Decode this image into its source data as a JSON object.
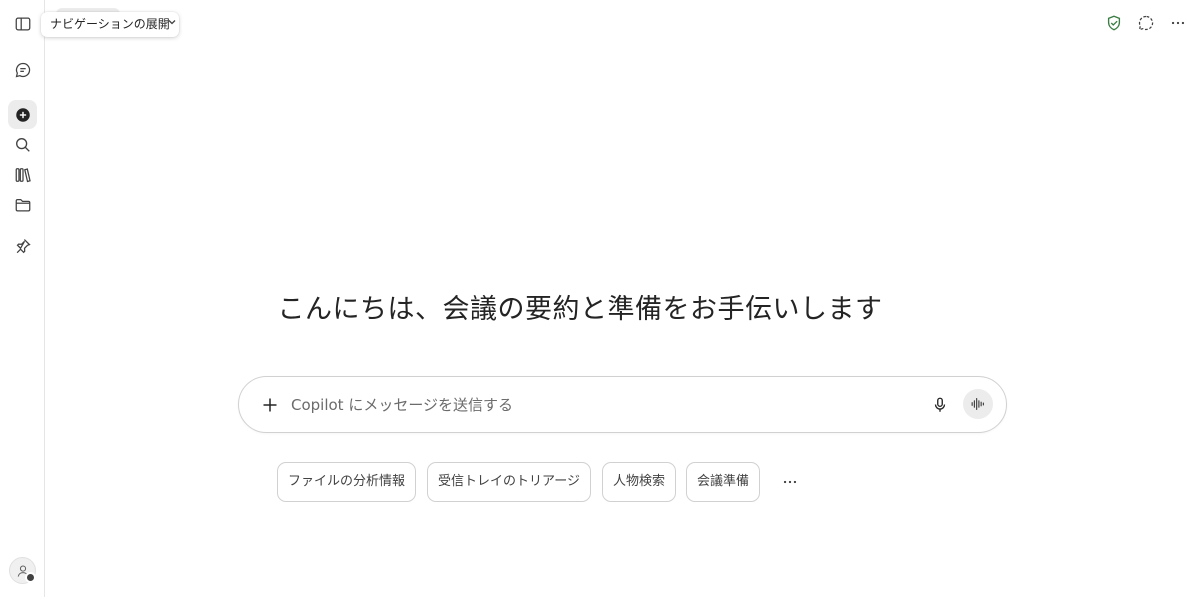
{
  "tooltip": {
    "text": "ナビゲーションの展開"
  },
  "sidebar": {
    "items": [
      {
        "name": "sidebar-toggle",
        "icon": "sidebar-panel-icon"
      },
      {
        "name": "chat",
        "icon": "chat-bubble-icon"
      },
      {
        "name": "new-chat",
        "icon": "plus-circle-icon"
      },
      {
        "name": "search",
        "icon": "search-icon"
      },
      {
        "name": "library",
        "icon": "library-icon"
      },
      {
        "name": "folder",
        "icon": "folder-icon"
      },
      {
        "name": "pin",
        "icon": "pin-icon"
      }
    ]
  },
  "header": {
    "icons": [
      "shield-check-icon",
      "chat-expand-icon",
      "more-horizontal-icon"
    ],
    "shield_color": "#3a7d44"
  },
  "main": {
    "greeting": "こんにちは、会議の要約と準備をお手伝いします"
  },
  "composer": {
    "placeholder": "Copilot にメッセージを送信する",
    "value": ""
  },
  "suggestions": [
    {
      "label": "ファイルの分析情報"
    },
    {
      "label": "受信トレイのトリアージ"
    },
    {
      "label": "人物検索"
    },
    {
      "label": "会議準備"
    }
  ]
}
